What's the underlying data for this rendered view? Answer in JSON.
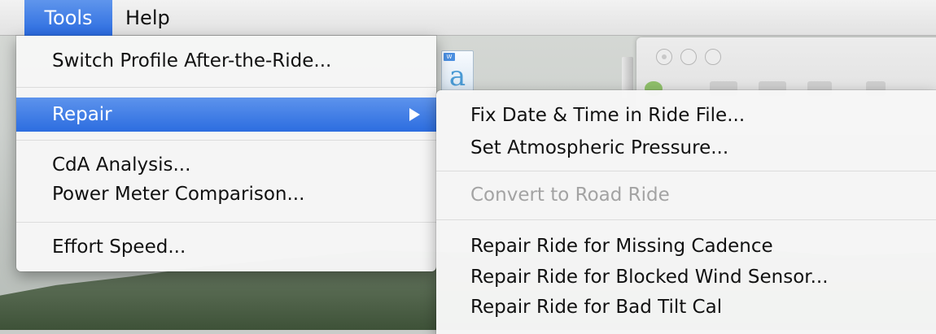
{
  "menubar": {
    "items": [
      {
        "label": "Tools",
        "active": true
      },
      {
        "label": "Help",
        "active": false
      }
    ]
  },
  "tools_menu": {
    "items": [
      {
        "label": "Switch Profile After-the-Ride..."
      },
      {
        "label": "Repair",
        "has_submenu": true,
        "highlighted": true
      },
      {
        "label": "CdA Analysis..."
      },
      {
        "label": "Power Meter Comparison..."
      },
      {
        "label": "Effort Speed..."
      }
    ]
  },
  "repair_submenu": {
    "items": [
      {
        "label": "Fix Date & Time in Ride File...",
        "enabled": true
      },
      {
        "label": "Set Atmospheric Pressure...",
        "enabled": true
      },
      {
        "label": "Convert to Road Ride",
        "enabled": false
      },
      {
        "label": "Repair Ride for Missing Cadence",
        "enabled": true
      },
      {
        "label": "Repair Ride for Blocked Wind Sensor...",
        "enabled": true
      },
      {
        "label": "Repair Ride for Bad Tilt Cal",
        "enabled": true
      }
    ]
  },
  "colors": {
    "highlight": "#2c6de0",
    "disabled_text": "#a3a3a3"
  },
  "icons": [
    "word-document-icon",
    "submenu-arrow-icon",
    "window-close-icon",
    "window-minimize-icon",
    "window-zoom-icon"
  ]
}
